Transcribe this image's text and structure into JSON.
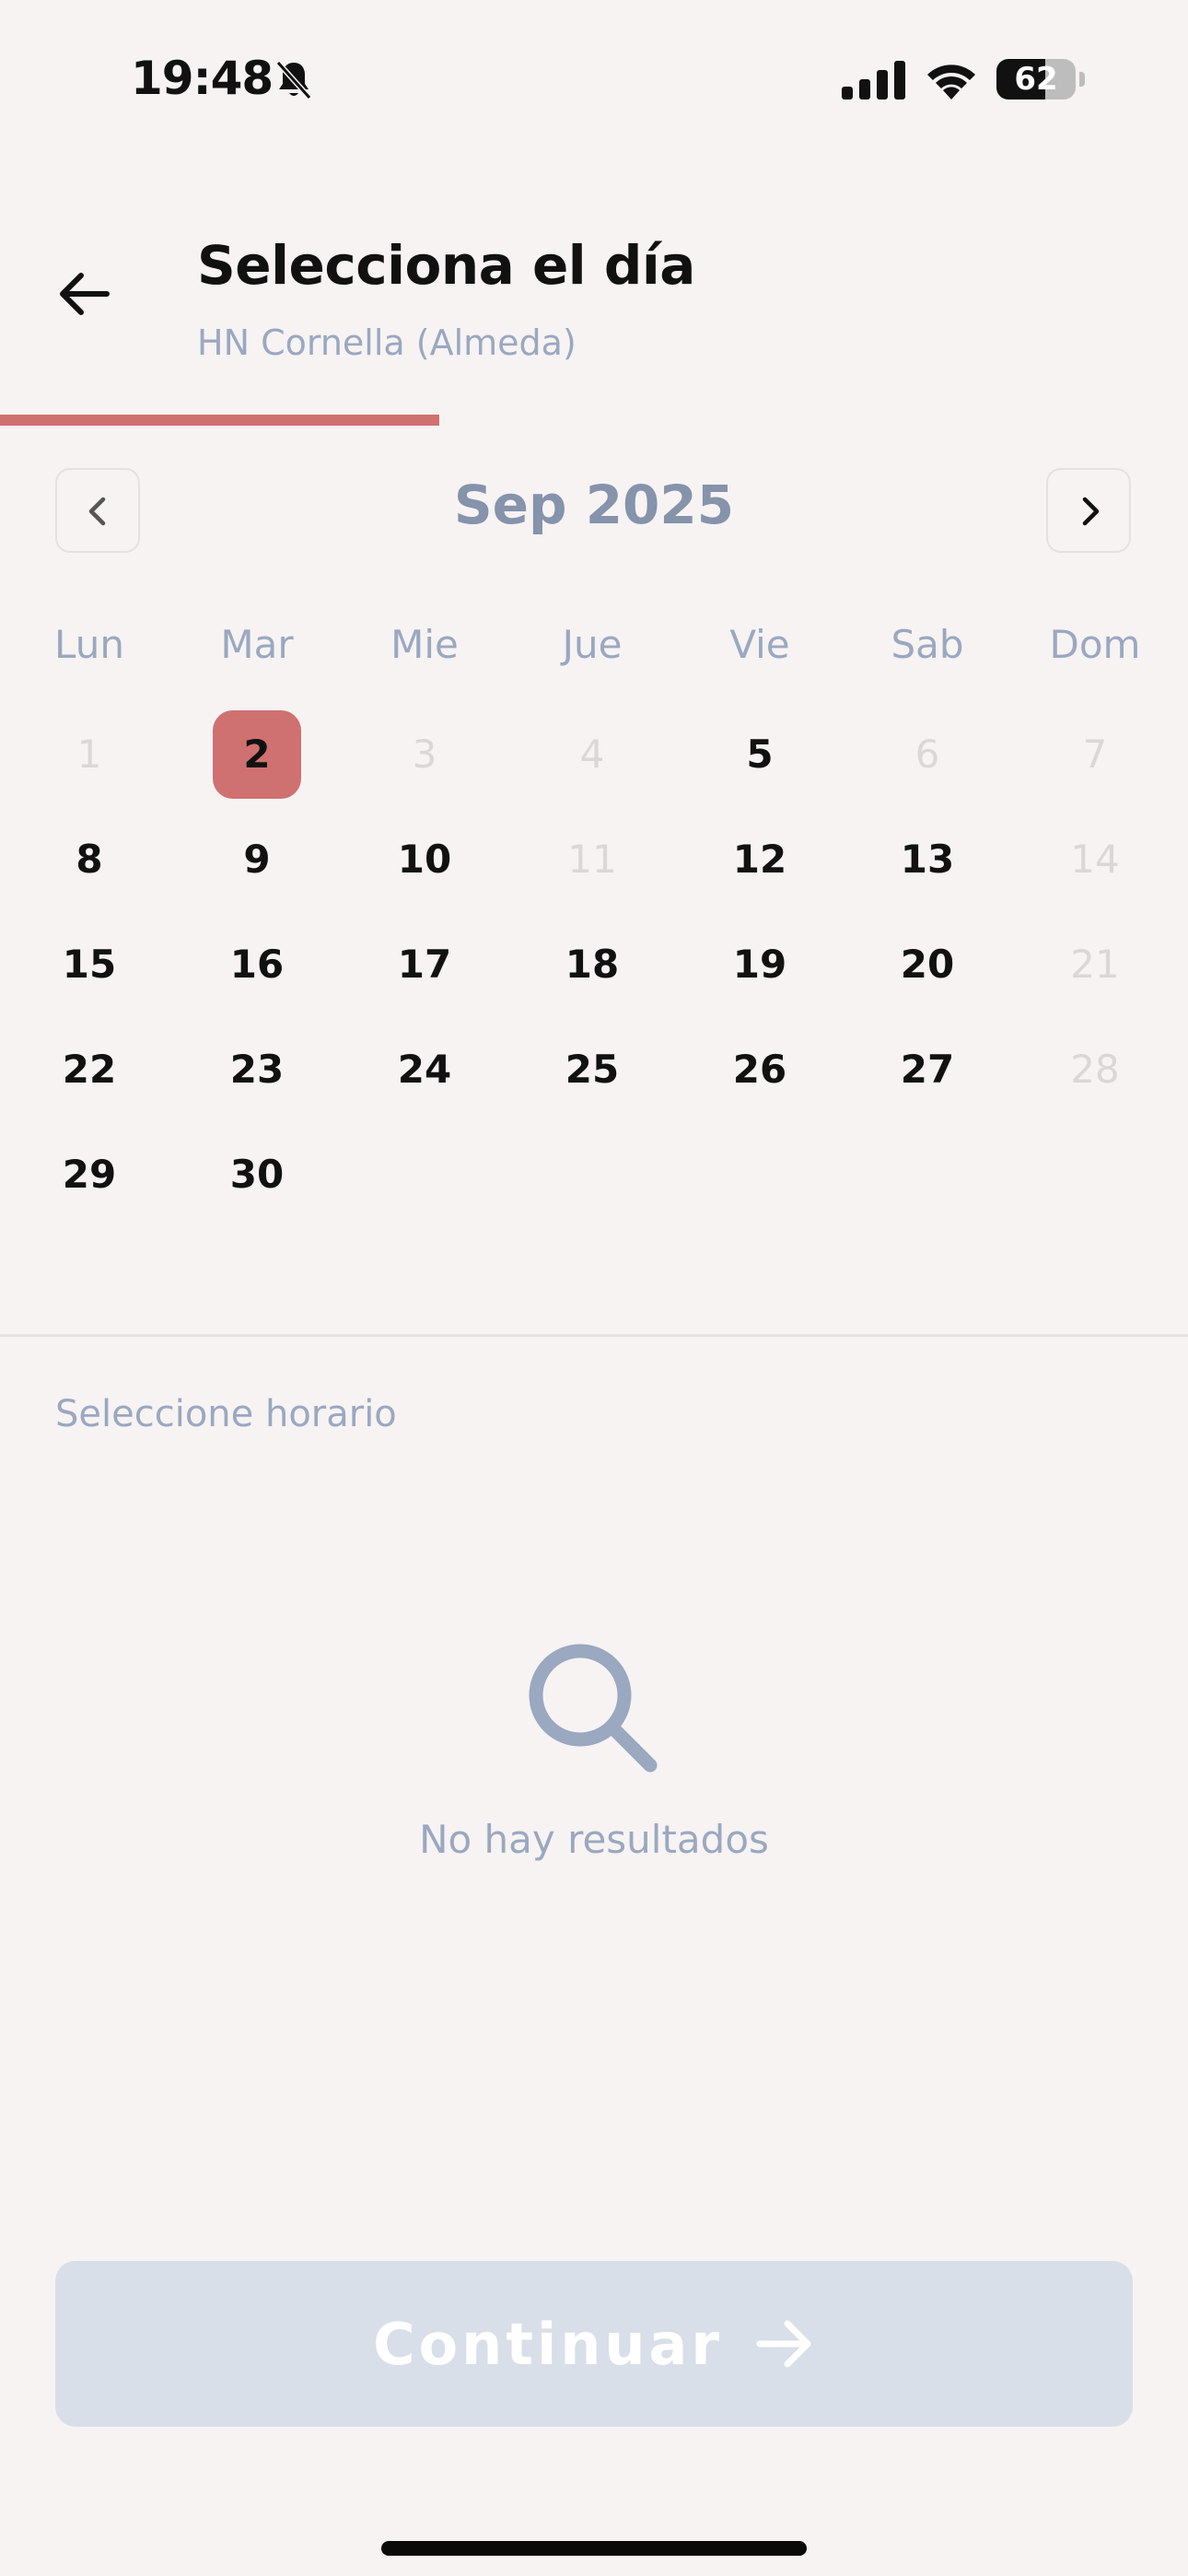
{
  "status_bar": {
    "time": "19:48",
    "battery": "62",
    "battery_level": 0.62
  },
  "header": {
    "title": "Selecciona el día",
    "subtitle": "HN Cornella (Almeda)",
    "progress": 0.37
  },
  "calendar": {
    "month_label": "Sep 2025",
    "weekdays": [
      "Lun",
      "Mar",
      "Mie",
      "Jue",
      "Vie",
      "Sab",
      "Dom"
    ],
    "weeks": [
      [
        {
          "d": "1",
          "s": "disabled"
        },
        {
          "d": "2",
          "s": "selected"
        },
        {
          "d": "3",
          "s": "disabled"
        },
        {
          "d": "4",
          "s": "disabled"
        },
        {
          "d": "5",
          "s": "enabled"
        },
        {
          "d": "6",
          "s": "disabled"
        },
        {
          "d": "7",
          "s": "disabled"
        }
      ],
      [
        {
          "d": "8",
          "s": "enabled"
        },
        {
          "d": "9",
          "s": "enabled"
        },
        {
          "d": "10",
          "s": "enabled"
        },
        {
          "d": "11",
          "s": "disabled"
        },
        {
          "d": "12",
          "s": "enabled"
        },
        {
          "d": "13",
          "s": "enabled"
        },
        {
          "d": "14",
          "s": "disabled"
        }
      ],
      [
        {
          "d": "15",
          "s": "enabled"
        },
        {
          "d": "16",
          "s": "enabled"
        },
        {
          "d": "17",
          "s": "enabled"
        },
        {
          "d": "18",
          "s": "enabled"
        },
        {
          "d": "19",
          "s": "enabled"
        },
        {
          "d": "20",
          "s": "enabled"
        },
        {
          "d": "21",
          "s": "disabled"
        }
      ],
      [
        {
          "d": "22",
          "s": "enabled"
        },
        {
          "d": "23",
          "s": "enabled"
        },
        {
          "d": "24",
          "s": "enabled"
        },
        {
          "d": "25",
          "s": "enabled"
        },
        {
          "d": "26",
          "s": "enabled"
        },
        {
          "d": "27",
          "s": "enabled"
        },
        {
          "d": "28",
          "s": "disabled"
        }
      ],
      [
        {
          "d": "29",
          "s": "enabled"
        },
        {
          "d": "30",
          "s": "enabled"
        }
      ]
    ]
  },
  "schedule": {
    "label": "Seleccione horario",
    "empty_text": "No hay resultados"
  },
  "footer": {
    "continue_label": "Continuar"
  },
  "colors": {
    "accent": "#cf7170",
    "muted": "#9aa8c0",
    "button_disabled": "#d9dfe8"
  },
  "icons": {
    "back": "arrow-left-icon",
    "prev": "chevron-left-icon",
    "next": "chevron-right-icon",
    "empty": "search-icon",
    "continue": "arrow-right-icon"
  }
}
